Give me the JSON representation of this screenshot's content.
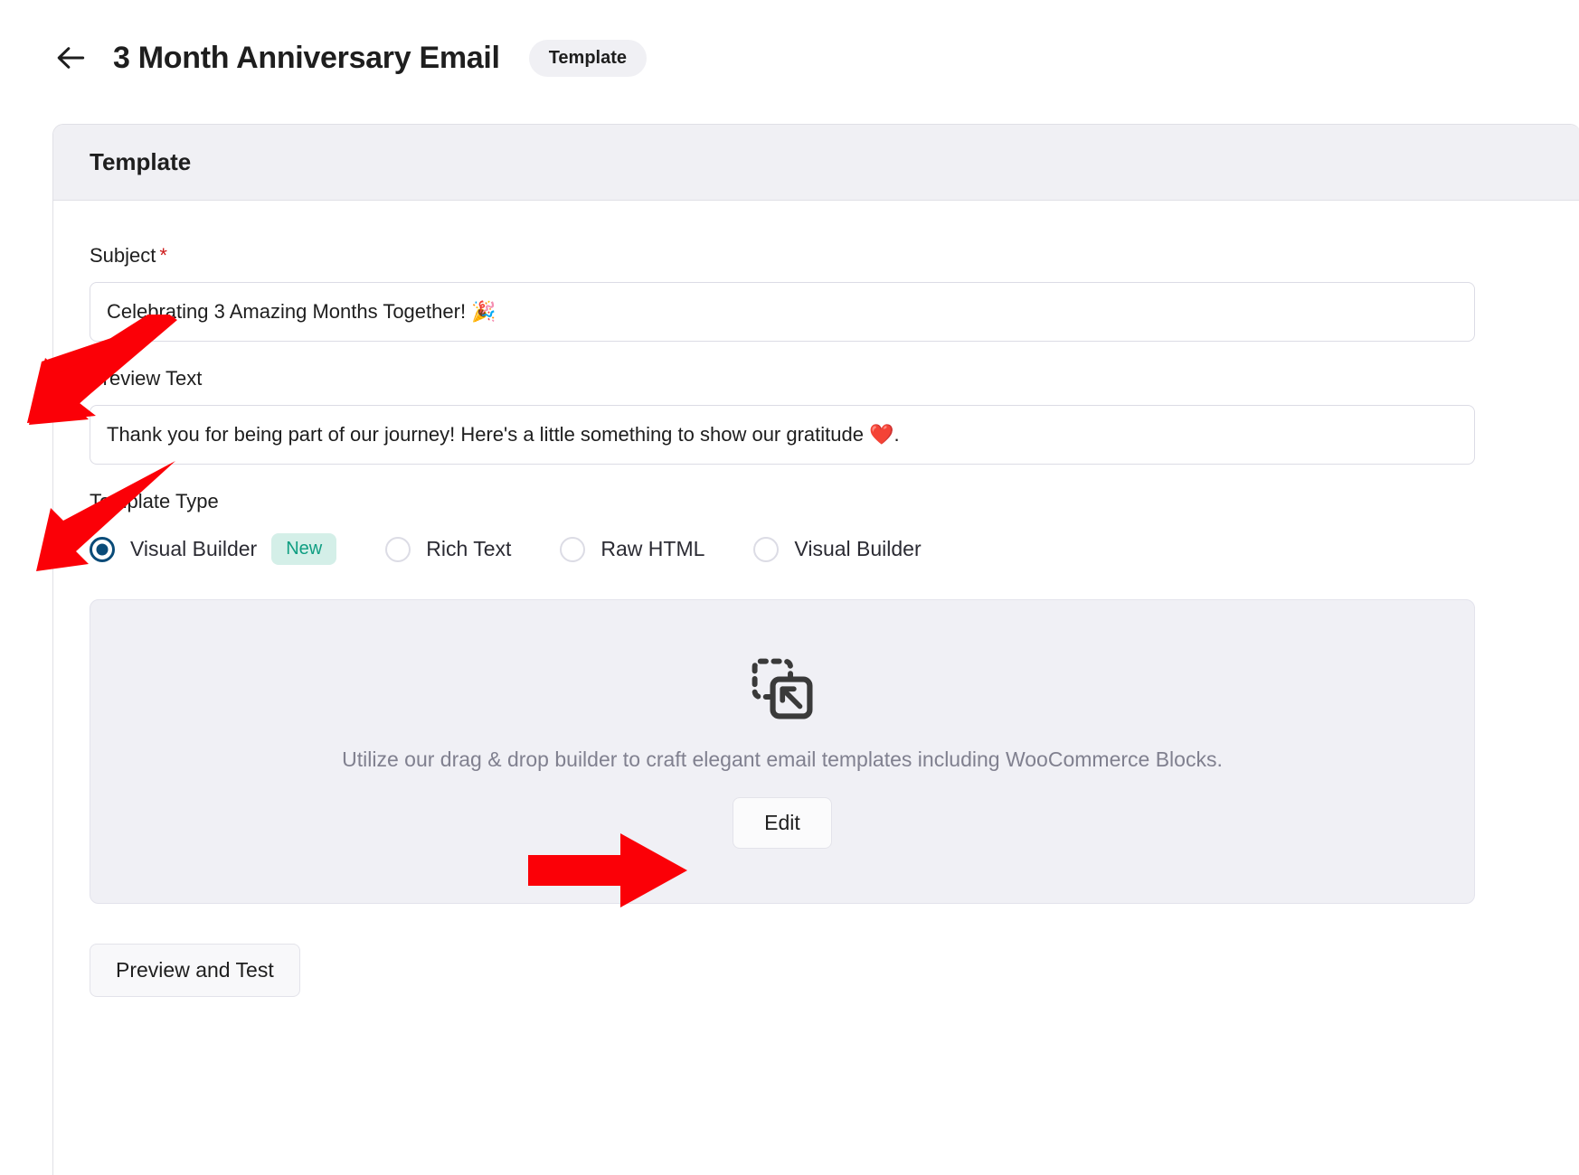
{
  "header": {
    "back_icon": "arrow-left-icon",
    "title": "3 Month Anniversary Email",
    "badge": "Template"
  },
  "card": {
    "header_title": "Template",
    "subject": {
      "label": "Subject",
      "required_mark": "*",
      "value": "Celebrating 3 Amazing Months Together! 🎉",
      "placeholder": "Subject"
    },
    "preview_text": {
      "label": "Preview Text",
      "value": "Thank you for being part of our journey! Here's a little something to show our gratitude ❤️.",
      "placeholder": "Preview Text"
    },
    "template_type": {
      "label": "Template Type",
      "selected_index": 0,
      "options": [
        {
          "label": "Visual Builder",
          "badge": "New",
          "checked": true
        },
        {
          "label": "Rich Text",
          "badge": "",
          "checked": false
        },
        {
          "label": "Raw HTML",
          "badge": "",
          "checked": false
        },
        {
          "label": "Visual Builder",
          "badge": "",
          "checked": false
        }
      ]
    },
    "dropzone": {
      "icon": "drag-drop-select-icon",
      "description": "Utilize our drag & drop builder to craft elegant email templates including WooCommerce Blocks.",
      "edit_button": "Edit"
    },
    "preview_and_test_button": "Preview and Test"
  },
  "annotations": {
    "arrow_color": "#fb0007",
    "arrow_count": 3,
    "targets": [
      "subject-input",
      "preview-text-input",
      "edit-button"
    ]
  },
  "colors": {
    "accent_radio": "#0a4b78",
    "badge_new_bg": "#d4efe8",
    "badge_new_text": "#0f9e82",
    "card_header_bg": "#f0f0f4",
    "dropzone_bg": "#f0f0f5",
    "required_asterisk": "#cc1818"
  }
}
